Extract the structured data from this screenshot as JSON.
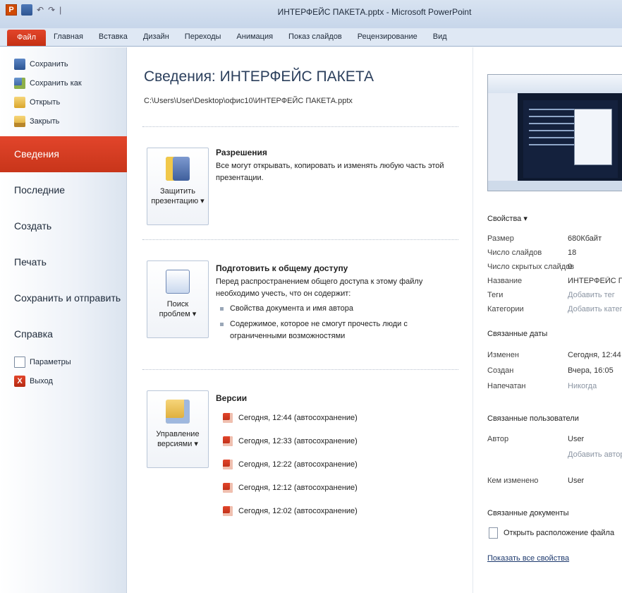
{
  "window": {
    "title": "ИНТЕРФЕЙС ПАКЕТА.pptx  -  Microsoft PowerPoint",
    "qat": {
      "undo": "↶",
      "redo": "↷",
      "sep": "|"
    },
    "logo_letter": "P"
  },
  "ribbon_tabs": [
    "Файл",
    "Главная",
    "Вставка",
    "Дизайн",
    "Переходы",
    "Анимация",
    "Показ слайдов",
    "Рецензирование",
    "Вид"
  ],
  "nav": {
    "commands_top": [
      "Сохранить",
      "Сохранить как",
      "Открыть",
      "Закрыть"
    ],
    "tabs": [
      "Сведения",
      "Последние",
      "Создать",
      "Печать",
      "Сохранить и отправить",
      "Справка"
    ],
    "commands_bottom": [
      "Параметры",
      "Выход"
    ],
    "exit_glyph": "X"
  },
  "main": {
    "title": "Сведения: ИНТЕРФЕЙС ПАКЕТА",
    "path": "C:\\Users\\User\\Desktop\\офис10\\ИНТЕРФЕЙС ПАКЕТА.pptx",
    "permissions": {
      "button_line1": "Защитить",
      "button_line2": "презентацию ▾",
      "heading": "Разрешения",
      "text": "Все могут открывать, копировать и изменять любую часть этой презентации."
    },
    "prepare": {
      "button_line1": "Поиск",
      "button_line2": "проблем ▾",
      "heading": "Подготовить к общему доступу",
      "text": "Перед распространением общего доступа к этому файлу необходимо учесть, что он содержит:",
      "bullets": [
        "Свойства документа и имя автора",
        "Содержимое, которое не смогут прочесть люди с ограниченными возможностями"
      ]
    },
    "versions": {
      "button_line1": "Управление",
      "button_line2": "версиями ▾",
      "heading": "Версии",
      "items": [
        "Сегодня, 12:44 (автосохранение)",
        "Сегодня, 12:33 (автосохранение)",
        "Сегодня, 12:22 (автосохранение)",
        "Сегодня, 12:12 (автосохранение)",
        "Сегодня, 12:02 (автосохранение)"
      ]
    }
  },
  "properties": {
    "heading": "Свойства ▾",
    "rows": [
      {
        "key": "Размер",
        "value": "680Кбайт"
      },
      {
        "key": "Число слайдов",
        "value": "18"
      },
      {
        "key": "Число скрытых слайдов",
        "value": "0"
      },
      {
        "key": "Название",
        "value": "ИНТЕРФЕЙС ПАКЕТА"
      },
      {
        "key": "Теги",
        "value": "Добавить тег"
      },
      {
        "key": "Категории",
        "value": "Добавить категорию"
      }
    ],
    "dates_heading": "Связанные даты",
    "dates": [
      {
        "key": "Изменен",
        "value": "Сегодня, 12:44"
      },
      {
        "key": "Создан",
        "value": "Вчера, 16:05"
      },
      {
        "key": "Напечатан",
        "value": "Никогда"
      }
    ],
    "people_heading": "Связанные пользователи",
    "author_key": "Автор",
    "author_value": "User",
    "add_author": "Добавить автора",
    "modified_by_key": "Кем изменено",
    "modified_by_value": "User",
    "docs_heading": "Связанные документы",
    "open_location": "Открыть расположение файла",
    "show_all": "Показать все свойства"
  }
}
